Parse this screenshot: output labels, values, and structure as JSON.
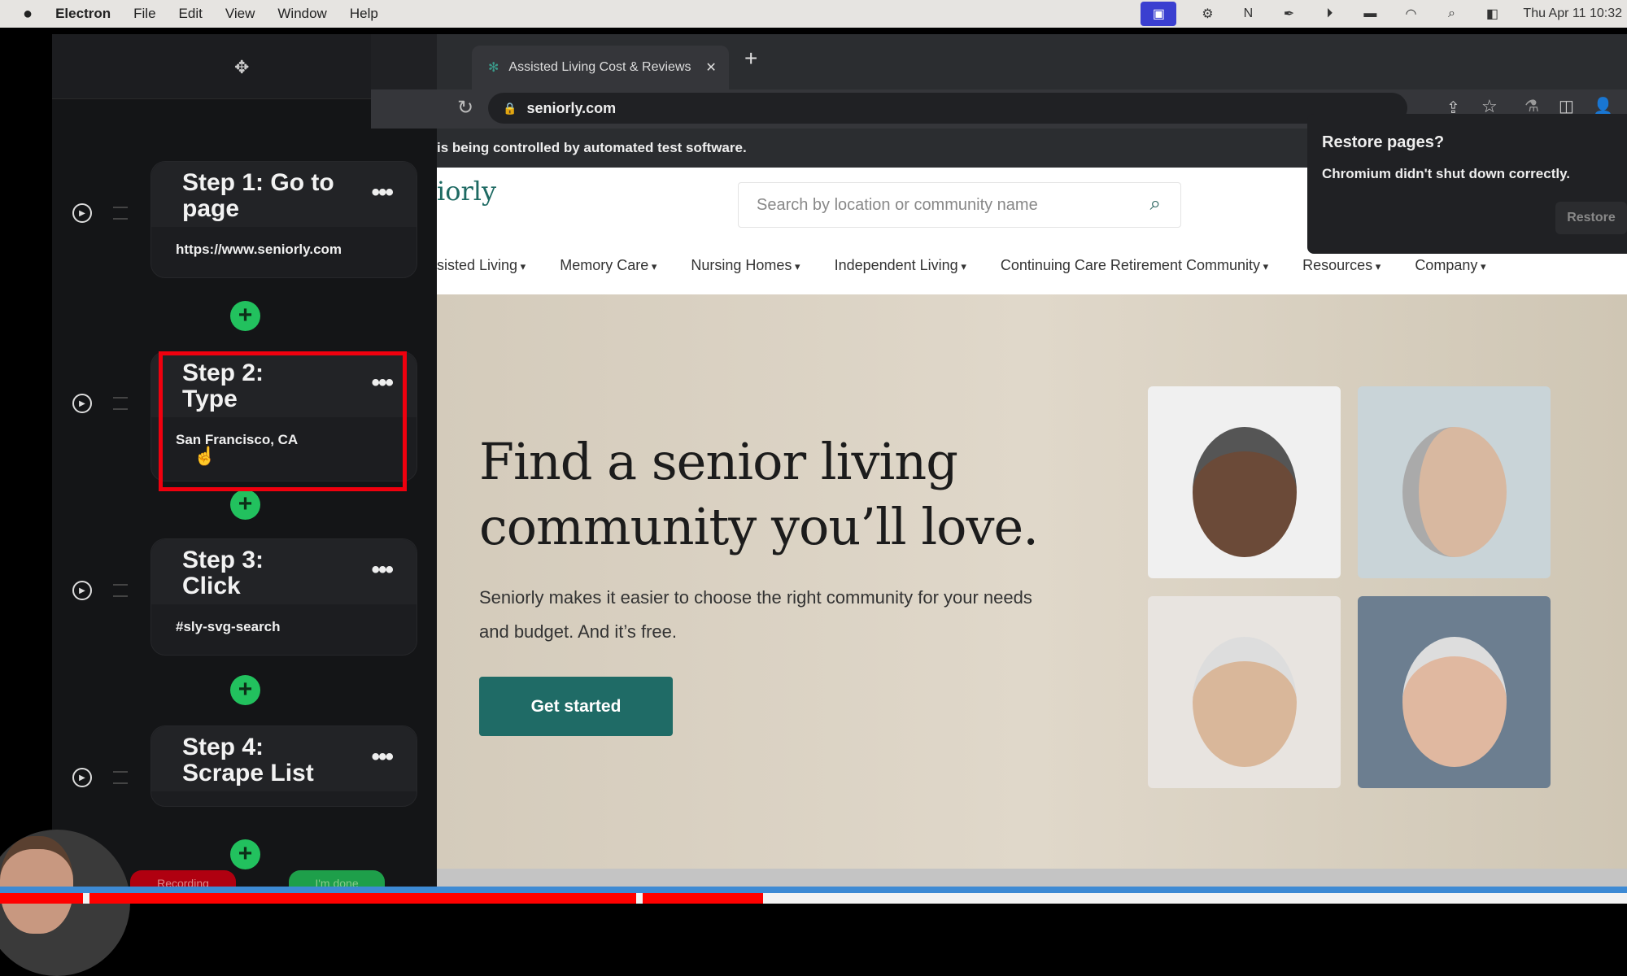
{
  "menubar": {
    "app": "Electron",
    "items": [
      "File",
      "Edit",
      "View",
      "Window",
      "Help"
    ],
    "clock": "Thu Apr 11  10:32",
    "tray_icons": [
      "screen-share-icon",
      "gear-icon",
      "notion-icon",
      "pen-icon",
      "play-icon",
      "battery-icon",
      "wifi-icon",
      "search-icon",
      "control-center-icon"
    ]
  },
  "sidebar": {
    "steps": [
      {
        "title": "Step 1: Go to page",
        "value": "https://www.seniorly.com"
      },
      {
        "title": "Step 2: Type",
        "value": "San Francisco, CA"
      },
      {
        "title": "Step 3: Click",
        "value": "#sly-svg-search"
      },
      {
        "title": "Step 4: Scrape List",
        "value": ""
      }
    ],
    "recording_label": "Recording",
    "done_label": "I'm done"
  },
  "browser": {
    "tab_title": "Assisted Living Cost & Reviews",
    "url": "seniorly.com",
    "infobar": "is being controlled by automated test software.",
    "popup": {
      "title": "Restore pages?",
      "message": "Chromium didn't shut down correctly.",
      "button": "Restore"
    }
  },
  "site": {
    "logo": "iorly",
    "search_placeholder": "Search by location or community name",
    "nav": [
      "sisted Living",
      "Memory Care",
      "Nursing Homes",
      "Independent Living",
      "Continuing Care Retirement Community",
      "Resources",
      "Company"
    ],
    "headline": "Find a senior living community you’ll love.",
    "subtext": "Seniorly makes it easier to choose the right community for your needs and budget. And it’s free.",
    "cta": "Get started"
  },
  "colors": {
    "brand": "#1f6b66",
    "add_step": "#22c15e",
    "highlight": "#f0000e"
  }
}
